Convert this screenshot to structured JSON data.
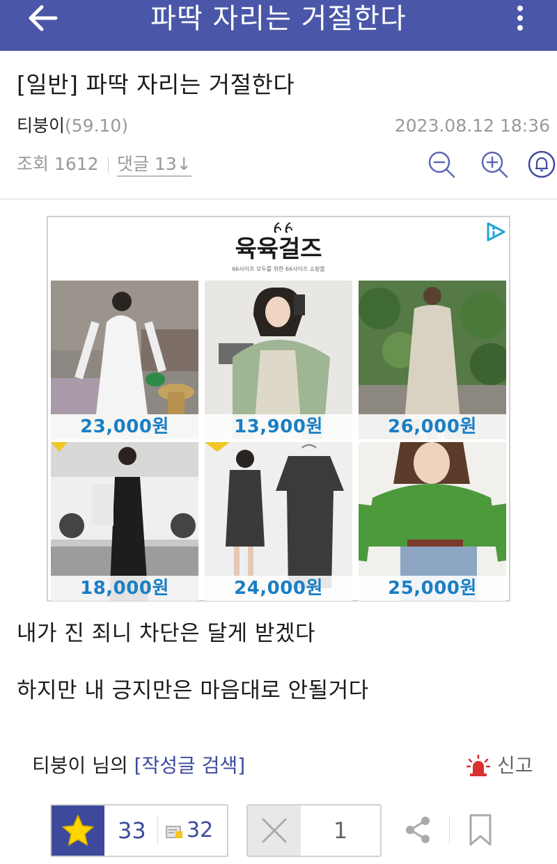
{
  "topbar": {
    "title": "파딱 자리는 거절한다",
    "back_icon": "arrow-left-icon",
    "more_icon": "more-vertical-icon"
  },
  "post": {
    "title": "[일반] 파딱 자리는 거절한다",
    "author": "티붕이",
    "author_score": "(59.10)",
    "date": "2023.08.12 18:36",
    "views": "조회 1612",
    "comments": "댓글 13↓"
  },
  "ad": {
    "brand": "육육걸즈",
    "tagline": "66사이즈 모두를 위한 66사이즈 쇼핑몰",
    "products": [
      {
        "price": "23,000원"
      },
      {
        "price": "13,900원"
      },
      {
        "price": "26,000원"
      },
      {
        "price": "18,000원"
      },
      {
        "price": "24,000원"
      },
      {
        "price": "25,000원"
      }
    ]
  },
  "body": {
    "lines": [
      "내가 진 죄니 차단은 달게 받겠다",
      "하지만 내 긍지만은 마음대로 안될거다"
    ]
  },
  "footer": {
    "author_posts_prefix": "티붕이 님의 ",
    "author_posts_link": "[작성글 검색]",
    "report": "신고",
    "star_count": "33",
    "scrap_count": "32",
    "x_count": "1"
  },
  "colors": {
    "brand": "#4a57a8",
    "accent": "#3d4a9c",
    "price": "#1a7fc4",
    "report": "#d93030"
  }
}
